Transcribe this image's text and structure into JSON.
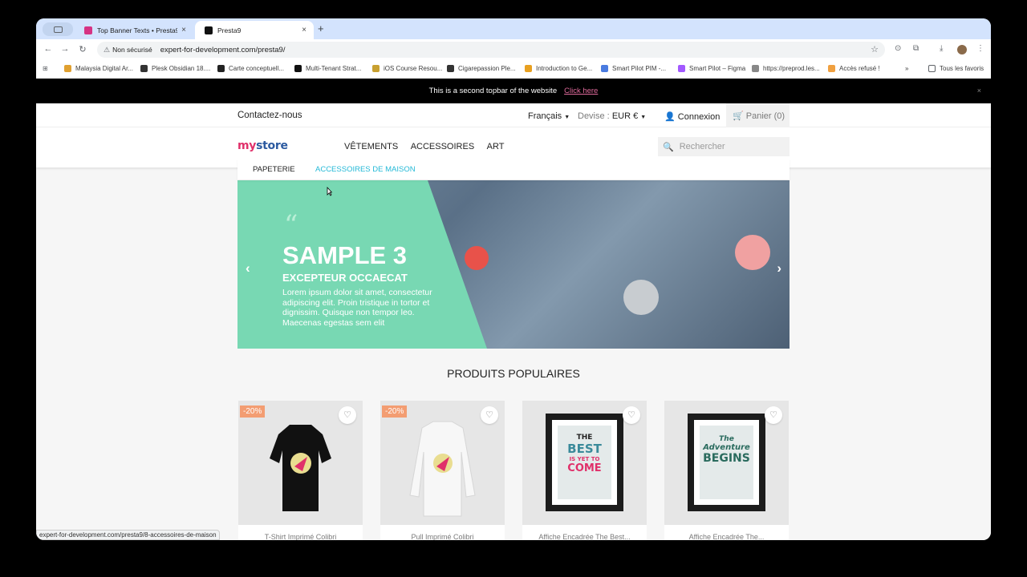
{
  "browser": {
    "tabs": [
      {
        "title": "Top Banner Texts • Presta9",
        "close": "×"
      },
      {
        "title": "Presta9",
        "close": "×"
      }
    ],
    "new_tab": "+",
    "security_label": "Non sécurisé",
    "url": "expert-for-development.com/presta9/",
    "bookmarks": [
      {
        "label": "Malaysia Digital Ar...",
        "color": "#e0a030"
      },
      {
        "label": "Plesk Obsidian 18....",
        "color": "#333333"
      },
      {
        "label": "Carte conceptuell...",
        "color": "#222222"
      },
      {
        "label": "Multi-Tenant Strat...",
        "color": "#111111"
      },
      {
        "label": "iOS Course Resou...",
        "color": "#c8a030"
      },
      {
        "label": "Cigarepassion Ple...",
        "color": "#333333"
      },
      {
        "label": "Introduction to Ge...",
        "color": "#e8a020"
      },
      {
        "label": "Smart Pilot PIM -...",
        "color": "#4a7be0"
      },
      {
        "label": "Smart Pilot – Figma",
        "color": "#a259ff"
      },
      {
        "label": "https://preprod.les...",
        "color": "#888888"
      },
      {
        "label": "Accès refusé !",
        "color": "#f0a040"
      }
    ],
    "more_bookmarks": "»",
    "all_favorites": "Tous les favoris",
    "status_url": "expert-for-development.com/presta9/8-accessoires-de-maison"
  },
  "site": {
    "topbar": {
      "text": "This is a second topbar of the website",
      "link": "Click here",
      "close": "×"
    },
    "contact": "Contactez-nous",
    "language": "Français",
    "currency_label": "Devise :",
    "currency_value": "EUR €",
    "login": "Connexion",
    "cart": "Panier (0)",
    "logo": {
      "part1": "my",
      "part2": "store"
    },
    "menu": [
      "VÊTEMENTS",
      "ACCESSOIRES",
      "ART"
    ],
    "search_placeholder": "Rechercher",
    "submenu": [
      "PAPETERIE",
      "ACCESSOIRES DE MAISON"
    ],
    "slider": {
      "quote": "“",
      "title": "SAMPLE 3",
      "subtitle": "EXCEPTEUR OCCAECAT",
      "text": "Lorem ipsum dolor sit amet, consectetur adipiscing elit. Proin tristique in tortor et dignissim. Quisque non tempor leo. Maecenas egestas sem elit",
      "accent_color": "#78d8b3"
    },
    "popular_title": "PRODUITS POPULAIRES",
    "products": [
      {
        "name": "T-Shirt Imprimé Colibri",
        "discount": "-20%"
      },
      {
        "name": "Pull Imprimé Colibri",
        "discount": "-20%"
      },
      {
        "name": "Affiche Encadrée The Best...",
        "discount": "",
        "art_lines": [
          "THE",
          "BEST",
          "IS YET TO",
          "COME"
        ]
      },
      {
        "name": "Affiche Encadrée The...",
        "discount": "",
        "art_lines": [
          "The",
          "Adventure",
          "BEGINS"
        ]
      }
    ]
  }
}
